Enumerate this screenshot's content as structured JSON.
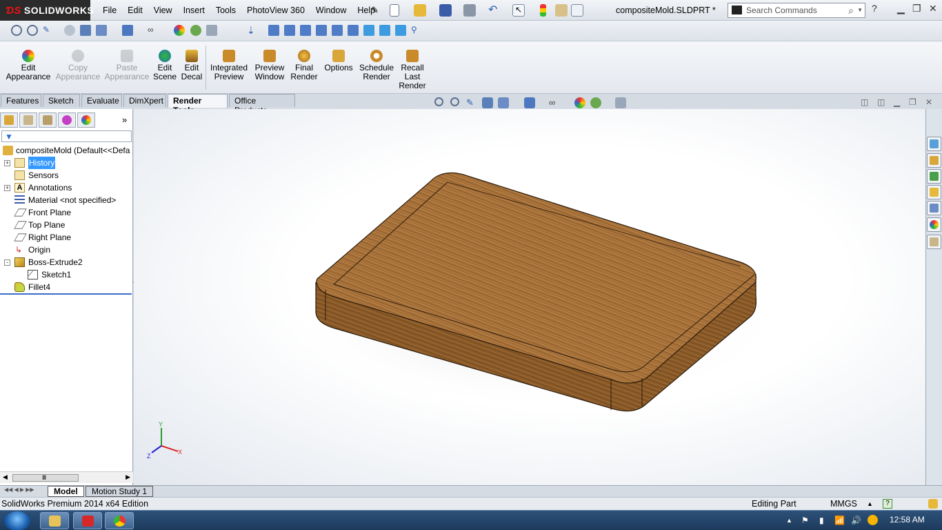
{
  "app": {
    "brand": "SOLIDWORKS",
    "document_title": "compositeMold.SLDPRT *"
  },
  "menu": [
    "File",
    "Edit",
    "View",
    "Insert",
    "Tools",
    "PhotoView 360",
    "Window",
    "Help"
  ],
  "search": {
    "placeholder": "Search Commands"
  },
  "ribbon": {
    "buttons": [
      {
        "label1": "Edit",
        "label2": "Appearance",
        "label3": "",
        "enabled": true,
        "icon": "appearance-ball-icon"
      },
      {
        "label1": "Copy",
        "label2": "Appearance",
        "label3": "",
        "enabled": false,
        "icon": "copy-appearance-icon"
      },
      {
        "label1": "Paste",
        "label2": "Appearance",
        "label3": "",
        "enabled": false,
        "icon": "paste-appearance-icon"
      },
      {
        "label1": "Edit",
        "label2": "Scene",
        "label3": "",
        "enabled": true,
        "icon": "edit-scene-icon"
      },
      {
        "label1": "Edit",
        "label2": "Decal",
        "label3": "",
        "enabled": true,
        "icon": "edit-decal-icon"
      },
      {
        "label1": "Integrated",
        "label2": "Preview",
        "label3": "",
        "enabled": true,
        "icon": "integrated-preview-icon"
      },
      {
        "label1": "Preview",
        "label2": "Window",
        "label3": "",
        "enabled": true,
        "icon": "preview-window-icon"
      },
      {
        "label1": "Final",
        "label2": "Render",
        "label3": "",
        "enabled": true,
        "icon": "final-render-icon"
      },
      {
        "label1": "Options",
        "label2": "",
        "label3": "",
        "enabled": true,
        "icon": "options-icon"
      },
      {
        "label1": "Schedule",
        "label2": "Render",
        "label3": "",
        "enabled": true,
        "icon": "schedule-render-icon"
      },
      {
        "label1": "Recall",
        "label2": "Last",
        "label3": "Render",
        "enabled": true,
        "icon": "recall-last-render-icon"
      }
    ]
  },
  "tabs": [
    {
      "label": "Features",
      "active": false
    },
    {
      "label": "Sketch",
      "active": false
    },
    {
      "label": "Evaluate",
      "active": false
    },
    {
      "label": "DimXpert",
      "active": false
    },
    {
      "label": "Render Tools",
      "active": true
    },
    {
      "label": "Office Products",
      "active": false
    }
  ],
  "feature_tree": {
    "root": "compositeMold  (Default<<Defa",
    "items": [
      {
        "label": "History",
        "icon": "history-icon",
        "expander": "+",
        "selected": true
      },
      {
        "label": "Sensors",
        "icon": "sensors-icon",
        "expander": "",
        "selected": false
      },
      {
        "label": "Annotations",
        "icon": "annotations-icon",
        "expander": "+",
        "selected": false
      },
      {
        "label": "Material <not specified>",
        "icon": "material-icon",
        "expander": "",
        "selected": false
      },
      {
        "label": "Front Plane",
        "icon": "plane-icon",
        "expander": "",
        "selected": false
      },
      {
        "label": "Top Plane",
        "icon": "plane-icon",
        "expander": "",
        "selected": false
      },
      {
        "label": "Right Plane",
        "icon": "plane-icon",
        "expander": "",
        "selected": false
      },
      {
        "label": "Origin",
        "icon": "origin-icon",
        "expander": "",
        "selected": false
      },
      {
        "label": "Boss-Extrude2",
        "icon": "boss-extrude-icon",
        "expander": "-",
        "selected": false
      },
      {
        "label": "Sketch1",
        "icon": "sketch-icon",
        "expander": "",
        "selected": false
      },
      {
        "label": "Fillet4",
        "icon": "fillet-icon",
        "expander": "",
        "selected": false
      }
    ]
  },
  "triad": {
    "y": "Y",
    "x": "X",
    "z": "Z"
  },
  "bottom_tabs": [
    {
      "label": "Model",
      "active": true
    },
    {
      "label": "Motion Study 1",
      "active": false
    }
  ],
  "status": {
    "edition": "SolidWorks Premium 2014 x64 Edition",
    "mode": "Editing Part",
    "units": "MMGS"
  },
  "taskbar": {
    "clock": "12:58 AM"
  },
  "colors": {
    "wood_light": "#a8743d",
    "wood_dark": "#7a4f22",
    "selection": "#3399ff",
    "brand_bar": "#2b2b2b"
  }
}
